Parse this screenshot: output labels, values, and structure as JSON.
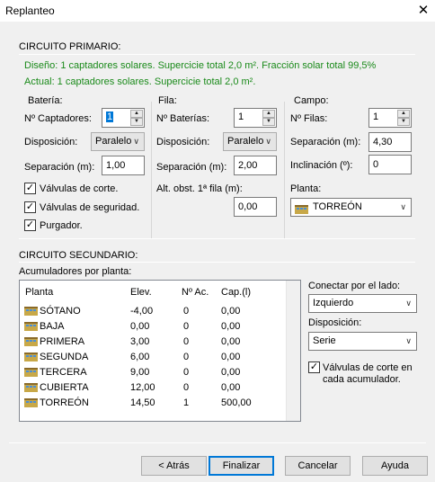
{
  "window": {
    "title": "Replanteo",
    "close_glyph": "✕"
  },
  "primario": {
    "heading": "CIRCUITO PRIMARIO:",
    "design_text": "Diseño: 1 captadores solares. Supercicie total 2,0 m². Fracción solar total 99,5%",
    "actual_text": "Actual: 1 captadores solares. Supercicie total 2,0 m².",
    "bateria": {
      "title": "Batería:",
      "captadores_label": "Nº Captadores:",
      "captadores_value": "1",
      "disposicion_label": "Disposición:",
      "disposicion_value": "Paralelo",
      "separacion_label": "Separación (m):",
      "separacion_value": "1,00",
      "valvulas_corte_label": "Válvulas de corte.",
      "valvulas_seguridad_label": "Válvulas de seguridad.",
      "purgador_label": "Purgador."
    },
    "fila": {
      "title": "Fila:",
      "baterias_label": "Nº Baterías:",
      "baterias_value": "1",
      "disposicion_label": "Disposición:",
      "disposicion_value": "Paralelo",
      "separacion_label": "Separación (m):",
      "separacion_value": "2,00",
      "alt_label": "Alt. obst. 1ª fila (m):",
      "alt_value": "0,00"
    },
    "campo": {
      "title": "Campo:",
      "filas_label": "Nº Filas:",
      "filas_value": "1",
      "separacion_label": "Separación (m):",
      "separacion_value": "4,30",
      "inclinacion_label": "Inclinación (º):",
      "inclinacion_value": "0",
      "planta_label": "Planta:",
      "planta_value": "TORREÓN"
    }
  },
  "secundario": {
    "heading": "CIRCUITO SECUNDARIO:",
    "list_label": "Acumuladores por planta:",
    "columns": [
      "Planta",
      "Elev.",
      "Nº Ac.",
      "Cap.(l)"
    ],
    "rows": [
      {
        "planta": "SÓTANO",
        "elev": "-4,00",
        "nac": "0",
        "cap": "0,00"
      },
      {
        "planta": "BAJA",
        "elev": "0,00",
        "nac": "0",
        "cap": "0,00"
      },
      {
        "planta": "PRIMERA",
        "elev": "3,00",
        "nac": "0",
        "cap": "0,00"
      },
      {
        "planta": "SEGUNDA",
        "elev": "6,00",
        "nac": "0",
        "cap": "0,00"
      },
      {
        "planta": "TERCERA",
        "elev": "9,00",
        "nac": "0",
        "cap": "0,00"
      },
      {
        "planta": "CUBIERTA",
        "elev": "12,00",
        "nac": "0",
        "cap": "0,00"
      },
      {
        "planta": "TORREÓN",
        "elev": "14,50",
        "nac": "1",
        "cap": "500,00"
      }
    ],
    "conectar_label": "Conectar por el lado:",
    "conectar_value": "Izquierdo",
    "disposicion_label": "Disposición:",
    "disposicion_value": "Serie",
    "valvulas_label_1": "Válvulas de corte en",
    "valvulas_label_2": "cada acumulador."
  },
  "buttons": {
    "atras": "< Atrás",
    "finalizar": "Finalizar",
    "cancelar": "Cancelar",
    "ayuda": "Ayuda"
  },
  "icons": {
    "spin_up": "▲",
    "spin_down": "▼",
    "dropdown": "chevron-down-icon",
    "check": "✓",
    "floor": "building-floor-icon"
  },
  "colors": {
    "green_text": "#1a8a1a",
    "accent": "#0078d7"
  }
}
